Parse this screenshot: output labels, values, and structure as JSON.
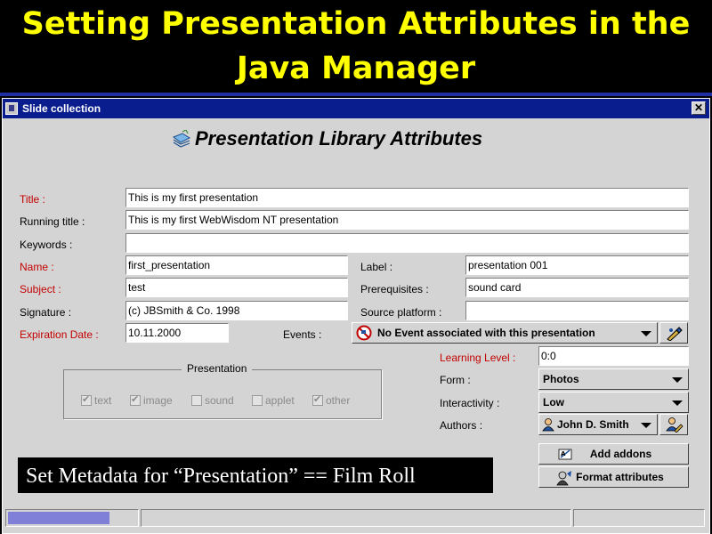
{
  "slide": {
    "title_line1": "Setting Presentation Attributes in the",
    "title_line2": "Java Manager"
  },
  "window": {
    "title": "Slide collection",
    "close_glyph": "✕"
  },
  "heading": "Presentation Library Attributes",
  "labels": {
    "title": "Title :",
    "running_title": "Running title :",
    "keywords": "Keywords :",
    "name": "Name :",
    "subject": "Subject :",
    "signature": "Signature :",
    "expiration_date": "Expiration Date :",
    "label": "Label :",
    "prerequisites": "Prerequisites :",
    "source_platform": "Source platform :",
    "events": "Events :",
    "learning_level": "Learning Level :",
    "form": "Form :",
    "interactivity": "Interactivity :",
    "authors": "Authors :"
  },
  "fields": {
    "title": "This is my first presentation",
    "running_title": "This is my first WebWisdom NT presentation",
    "keywords": "",
    "name": "first_presentation",
    "subject": "test",
    "signature": "(c) JBSmith & Co. 1998",
    "expiration_date": "10.11.2000",
    "label": "presentation 001",
    "prerequisites": "sound card",
    "source_platform": "",
    "learning_level": "0:0"
  },
  "combos": {
    "events": "No Event associated with this presentation",
    "form": "Photos",
    "interactivity": "Low",
    "authors": "John D. Smith"
  },
  "presentation_group": {
    "title": "Presentation",
    "options": [
      {
        "label": "text",
        "checked": true
      },
      {
        "label": "image",
        "checked": true
      },
      {
        "label": "sound",
        "checked": false
      },
      {
        "label": "applet",
        "checked": false
      },
      {
        "label": "other",
        "checked": true
      }
    ]
  },
  "buttons": {
    "add_addons": "Add addons",
    "format_attributes": "Format attributes"
  },
  "caption": "Set Metadata for  “Presentation” == Film Roll",
  "status": {
    "progress": 0.9
  },
  "colors": {
    "slide_title": "#ffff00",
    "window_titlebar": "#0a1d8e",
    "required_label": "#c40000",
    "window_bg": "#d4d4d4"
  }
}
